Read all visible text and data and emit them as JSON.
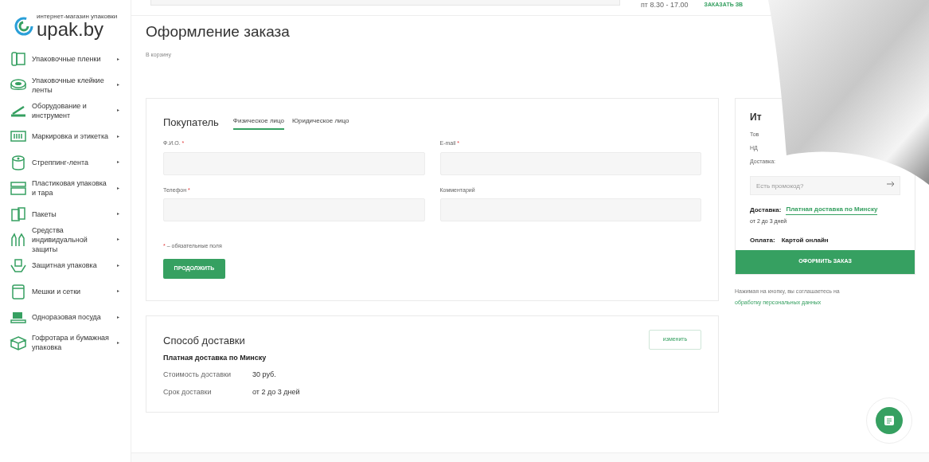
{
  "logo": {
    "tagline": "интернет-магазин упаковки",
    "name": "upak.by"
  },
  "header": {
    "hours": "пт 8.30 - 17.00",
    "callback_link": "ЗАКАЗАТЬ ЗВ"
  },
  "sidebar": {
    "items": [
      {
        "label": "Упаковочные пленки",
        "arrow": "▸"
      },
      {
        "label": "Упаковочные клейкие ленты",
        "arrow": "▸"
      },
      {
        "label": "Оборудование и инструмент",
        "arrow": "▸"
      },
      {
        "label": "Маркировка и этикетка",
        "arrow": "▸"
      },
      {
        "label": "Стреппинг-лента",
        "arrow": "▸"
      },
      {
        "label": "Пластиковая упаковка и тара",
        "arrow": "▸"
      },
      {
        "label": "Пакеты",
        "arrow": "▸"
      },
      {
        "label": "Средства индивидуальной защиты",
        "arrow": "▸"
      },
      {
        "label": "Защитная упаковка",
        "arrow": "▸"
      },
      {
        "label": "Мешки и сетки",
        "arrow": "▸"
      },
      {
        "label": "Одноразовая посуда",
        "arrow": "▸"
      },
      {
        "label": "Гофротара и бумажная упаковка",
        "arrow": "▸"
      }
    ]
  },
  "page": {
    "title": "Оформление заказа",
    "back_link": "В корзину"
  },
  "buyer": {
    "title": "Покупатель",
    "tabs": [
      {
        "label": "Физическое лицо",
        "selected": true
      },
      {
        "label": "Юридическое лицо",
        "selected": false
      }
    ],
    "fields": [
      {
        "label": "Ф.И.О.",
        "required": true
      },
      {
        "label": "E-mail",
        "required": true
      },
      {
        "label": "Телефон",
        "required": true
      },
      {
        "label": "Комментарий",
        "required": false
      }
    ],
    "required_mark": "*",
    "required_note": "– обязательные поля",
    "continue_button": "ПРОДОЛЖИТЬ"
  },
  "delivery": {
    "title": "Способ доставки",
    "change_button": "изменить",
    "method": "Платная доставка по Минску",
    "rows": [
      {
        "label": "Стоимость доставки",
        "value": "30 руб."
      },
      {
        "label": "Срок доставки",
        "value": "от 2 до 3 дней"
      }
    ]
  },
  "summary": {
    "title": "Ит",
    "lines": [
      "Тов",
      "НД",
      "Доставка:"
    ],
    "promo_placeholder": "Есть промокод?",
    "delivery_label": "Доставка:",
    "delivery_value": "Платная доставка по Минску",
    "delivery_term": "от 2 до 3 дней",
    "payment_label": "Оплата:",
    "payment_value": "Картой онлайн",
    "submit_button": "ОФОРМИТЬ ЗАКАЗ",
    "consent_text": "Нажимая на кнопку, вы соглашаетесь на",
    "consent_link": "обработку персональных данных"
  }
}
